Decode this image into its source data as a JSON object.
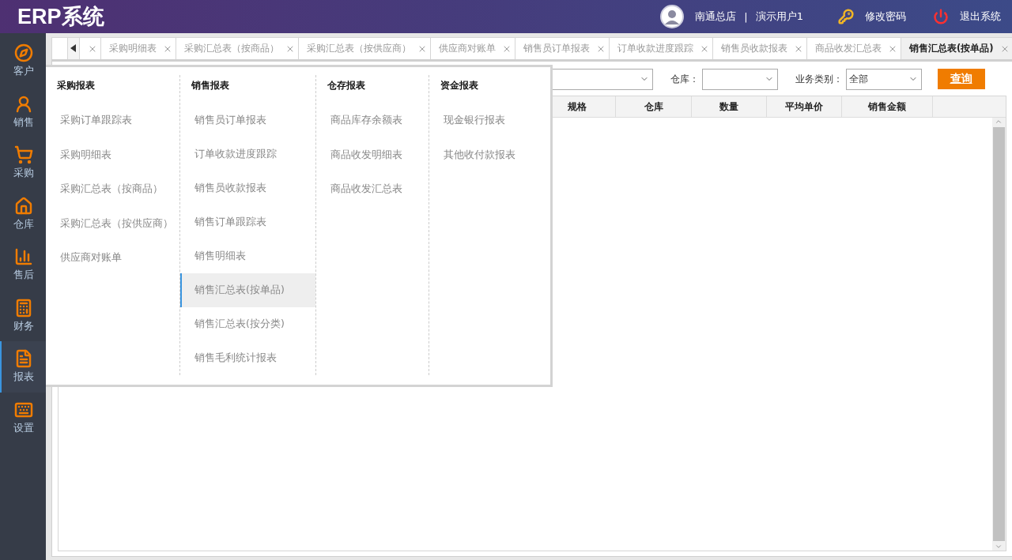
{
  "header": {
    "title": "ERP系统",
    "store": "南通总店",
    "separator": "|",
    "user": "演示用户1",
    "actions": [
      {
        "kind": "key",
        "label": "修改密码"
      },
      {
        "kind": "power",
        "label": "退出系统"
      }
    ]
  },
  "sidebar": {
    "items": [
      {
        "kind": "compass",
        "label": "客户",
        "selected": false
      },
      {
        "kind": "person",
        "label": "销售",
        "selected": false
      },
      {
        "kind": "cart",
        "label": "采购",
        "selected": false
      },
      {
        "kind": "house",
        "label": "仓库",
        "selected": false
      },
      {
        "kind": "bars",
        "label": "售后",
        "selected": false
      },
      {
        "kind": "abacus",
        "label": "财务",
        "selected": false
      },
      {
        "kind": "document",
        "label": "报表",
        "selected": true
      },
      {
        "kind": "keyboard",
        "label": "设置",
        "selected": false
      }
    ]
  },
  "tabs": [
    {
      "selected": false
    },
    {
      "label": "采购明细表",
      "selected": false
    },
    {
      "label": "采购汇总表（按商品）",
      "selected": false
    },
    {
      "label": "采购汇总表（按供应商）",
      "selected": false
    },
    {
      "label": "供应商对账单",
      "selected": false
    },
    {
      "label": "销售员订单报表",
      "selected": false
    },
    {
      "label": "订单收款进度跟踪",
      "selected": false
    },
    {
      "label": "销售员收款报表",
      "selected": false
    },
    {
      "label": "商品收发汇总表",
      "selected": false
    },
    {
      "label": "销售汇总表(按单品)",
      "selected": true
    }
  ],
  "filters": [
    {
      "kind": "select"
    },
    {
      "kind": "select",
      "label": "仓库："
    },
    {
      "kind": "select",
      "label": "业务类别：",
      "value": "全部"
    }
  ],
  "query_button": "查询",
  "table": {
    "columns": [
      "规格",
      "仓库",
      "数量",
      "平均单价",
      "销售金额"
    ]
  },
  "menu": {
    "columns": [
      {
        "heading": "采购报表",
        "items": [
          {
            "label": "采购订单跟踪表",
            "selected": false
          },
          {
            "label": "采购明细表",
            "selected": false
          },
          {
            "label": "采购汇总表（按商品）",
            "selected": false
          },
          {
            "label": "采购汇总表（按供应商）",
            "selected": false
          },
          {
            "label": "供应商对账单",
            "selected": false
          }
        ]
      },
      {
        "heading": "销售报表",
        "items": [
          {
            "label": "销售员订单报表",
            "selected": false
          },
          {
            "label": "订单收款进度跟踪",
            "selected": false
          },
          {
            "label": "销售员收款报表",
            "selected": false
          },
          {
            "label": "销售订单跟踪表",
            "selected": false
          },
          {
            "label": "销售明细表",
            "selected": false
          },
          {
            "label": "销售汇总表(按单品)",
            "selected": true
          },
          {
            "label": "销售汇总表(按分类)",
            "selected": false
          },
          {
            "label": "销售毛利统计报表",
            "selected": false
          }
        ]
      },
      {
        "heading": "仓存报表",
        "items": [
          {
            "label": "商品库存余额表",
            "selected": false
          },
          {
            "label": "商品收发明细表",
            "selected": false
          },
          {
            "label": "商品收发汇总表",
            "selected": false
          }
        ]
      },
      {
        "heading": "资金报表",
        "items": [
          {
            "label": "现金银行报表",
            "selected": false
          },
          {
            "label": "其他收付款报表",
            "selected": false
          }
        ]
      }
    ]
  }
}
